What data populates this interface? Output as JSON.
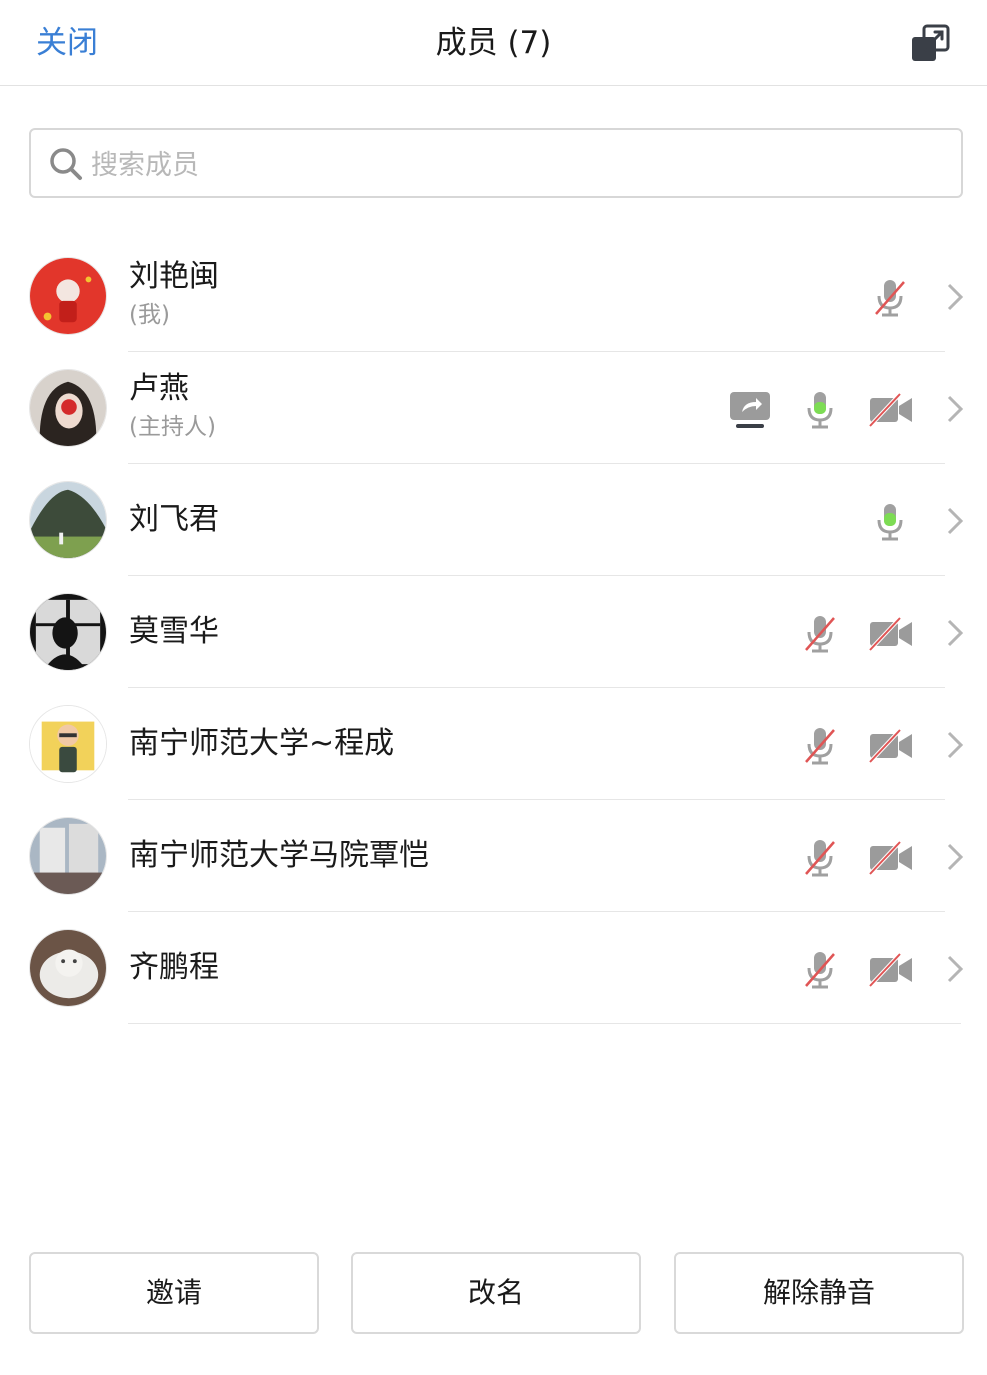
{
  "header": {
    "close_label": "关闭",
    "title": "成员 (7)"
  },
  "search": {
    "placeholder": "搜索成员",
    "value": ""
  },
  "members": [
    {
      "name": "刘艳闽",
      "role": "(我)",
      "mic": "muted",
      "camera": "none",
      "sharing": false
    },
    {
      "name": "卢燕",
      "role": "(主持人)",
      "mic": "active",
      "camera": "off",
      "sharing": true
    },
    {
      "name": "刘飞君",
      "role": "",
      "mic": "active",
      "camera": "none",
      "sharing": false
    },
    {
      "name": "莫雪华",
      "role": "",
      "mic": "muted",
      "camera": "off",
      "sharing": false
    },
    {
      "name": "南宁师范大学~程成",
      "role": "",
      "mic": "muted",
      "camera": "off",
      "sharing": false
    },
    {
      "name": "南宁师范大学马院覃恺",
      "role": "",
      "mic": "muted",
      "camera": "off",
      "sharing": false
    },
    {
      "name": "齐鹏程",
      "role": "",
      "mic": "muted",
      "camera": "off",
      "sharing": false
    }
  ],
  "footer": {
    "invite_label": "邀请",
    "rename_label": "改名",
    "unmute_label": "解除静音"
  },
  "colors": {
    "accent": "#3a7fd5",
    "mic_active": "#7ddc54",
    "muted_slash": "#e05555",
    "icon_gray": "#9b9b9b"
  }
}
